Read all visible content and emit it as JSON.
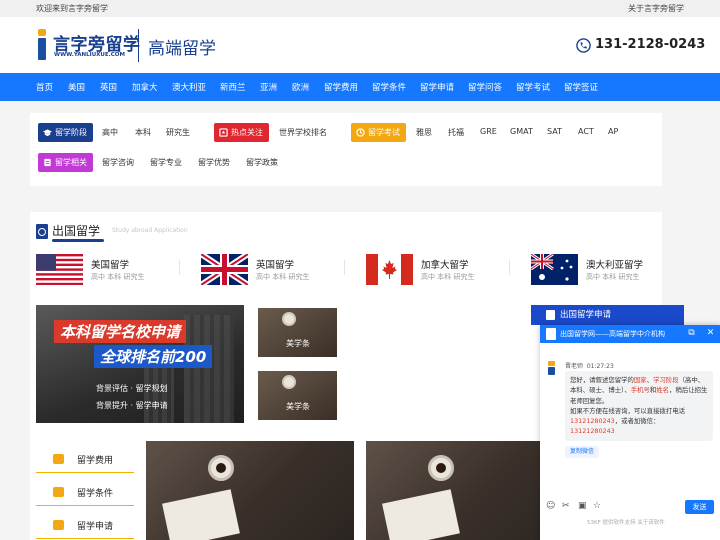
{
  "topbar": {
    "welcome": "欢迎来到言字旁留学",
    "about": "关于言字旁留学"
  },
  "header": {
    "logo_text": "言字旁留学",
    "logo_url": "WWW.YANLIUXUE.COM",
    "slogan": "高端留学",
    "phone": "131-2128-0243",
    "phone_icon": "phone-icon"
  },
  "nav": [
    "首页",
    "美国",
    "英国",
    "加拿大",
    "澳大利亚",
    "新西兰",
    "亚洲",
    "欧洲",
    "留学费用",
    "留学条件",
    "留学申请",
    "留学问答",
    "留学考试",
    "留学签证"
  ],
  "filters": {
    "stage": {
      "label": "留学阶段",
      "items": [
        "高中",
        "本科",
        "研究生"
      ],
      "color": "#1a3f8f"
    },
    "hot": {
      "label": "热点关注",
      "items": [
        "世界学校排名"
      ],
      "color": "#e0262e"
    },
    "exam": {
      "label": "留学考试",
      "items": [
        "雅思",
        "托福",
        "GRE",
        "GMAT",
        "SAT",
        "ACT",
        "AP"
      ],
      "color": "#f3a712"
    },
    "related": {
      "label": "留学相关",
      "items": [
        "留学咨询",
        "留学专业",
        "留学优势",
        "留学政策"
      ],
      "color": "#c23ad6"
    }
  },
  "section": {
    "title": "出国留学",
    "subtitle": "Study abroad Application",
    "countries": [
      {
        "name": "美国留学",
        "levels": "高中 本科 研究生",
        "flag": "us-flag"
      },
      {
        "name": "英国留学",
        "levels": "高中 本科 研究生",
        "flag": "uk-flag"
      },
      {
        "name": "加拿大留学",
        "levels": "高中 本科 研究生",
        "flag": "canada-flag"
      },
      {
        "name": "澳大利亚留学",
        "levels": "高中 本科 研究生",
        "flag": "australia-flag"
      }
    ],
    "banner": {
      "line1": "本科留学名校申请",
      "line2": "全球排名前200",
      "sub1": "背景评估 · 留学规划",
      "sub2": "背景提升 · 留学申请"
    },
    "thumbs": [
      "美学条",
      "美学条"
    ],
    "apply_label": "出国留学申请",
    "side_menu": [
      "留学费用",
      "留学条件",
      "留学申请"
    ]
  },
  "chat": {
    "title": "出国留学网——高端留学中介机构",
    "agent": "晋老师",
    "time": "01:27:23",
    "msg": {
      "p1": "您好，请叙述您留学的",
      "h1": "国家",
      "p2": "、",
      "h2": "学习阶段",
      "p3": "（高中、本科、硕士、博士）、",
      "h3": "手机号",
      "p4": "和",
      "h4": "姓名",
      "p5": "，稍后让招生老师回复您。",
      "p6": "如果不方便在线咨询，可以直接拨打电话",
      "h5": "13121280243",
      "p7": "，或者加微信：",
      "h6": "13121280243"
    },
    "copy_label": "复制微信",
    "send_label": "发送",
    "footer": "53KF 提供软件支持  关于该软件"
  },
  "colors": {
    "nav_bg": "#1677ff",
    "brand": "#1a3f8f",
    "accent": "#f3a712",
    "highlight": "#e23a2a"
  }
}
